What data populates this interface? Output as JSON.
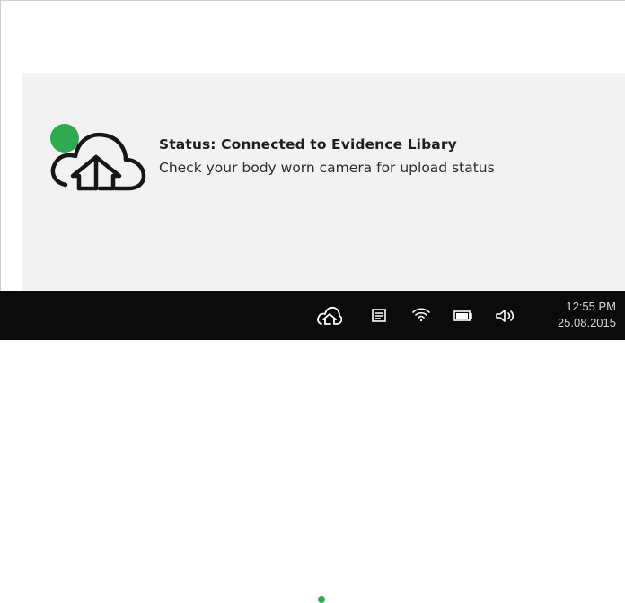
{
  "notification": {
    "title": "Status: Connected to Evidence Libary",
    "message": "Check your body worn camera for upload status",
    "icon": "cloud-upload-icon",
    "status_color": "#2faa4f"
  },
  "taskbar": {
    "tray_icons": [
      "cloud-upload-icon",
      "notes-icon",
      "wifi-icon",
      "battery-icon",
      "volume-icon"
    ],
    "time": "12:55 PM",
    "date": "25.08.2015"
  }
}
